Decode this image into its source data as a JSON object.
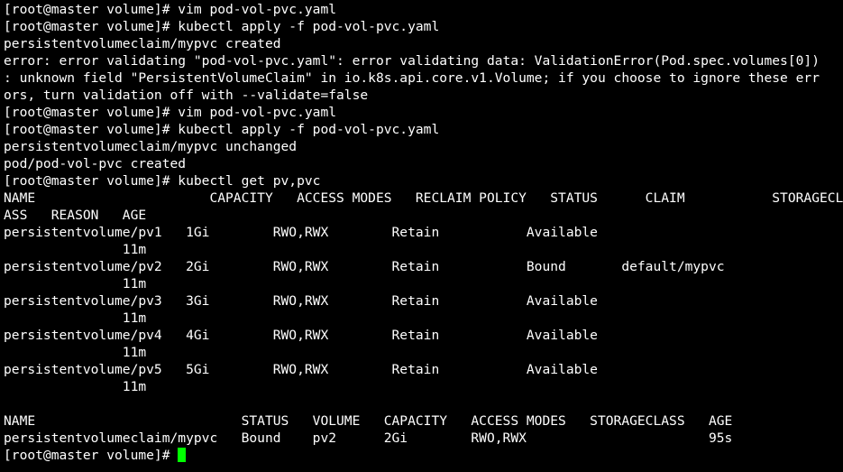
{
  "colors": {
    "background": "#000000",
    "foreground": "#ffffff",
    "cursor": "#00ff00"
  },
  "lines": [
    "[root@master volume]# vim pod-vol-pvc.yaml",
    "[root@master volume]# kubectl apply -f pod-vol-pvc.yaml",
    "persistentvolumeclaim/mypvc created",
    "error: error validating \"pod-vol-pvc.yaml\": error validating data: ValidationError(Pod.spec.volumes[0])",
    ": unknown field \"PersistentVolumeClaim\" in io.k8s.api.core.v1.Volume; if you choose to ignore these err",
    "ors, turn validation off with --validate=false",
    "[root@master volume]# vim pod-vol-pvc.yaml",
    "[root@master volume]# kubectl apply -f pod-vol-pvc.yaml",
    "persistentvolumeclaim/mypvc unchanged",
    "pod/pod-vol-pvc created",
    "[root@master volume]# kubectl get pv,pvc",
    "NAME                      CAPACITY   ACCESS MODES   RECLAIM POLICY   STATUS      CLAIM           STORAGECL",
    "ASS   REASON   AGE",
    "persistentvolume/pv1   1Gi        RWO,RWX        Retain           Available",
    "               11m",
    "persistentvolume/pv2   2Gi        RWO,RWX        Retain           Bound       default/mypvc",
    "               11m",
    "persistentvolume/pv3   3Gi        RWO,RWX        Retain           Available",
    "               11m",
    "persistentvolume/pv4   4Gi        RWO,RWX        Retain           Available",
    "               11m",
    "persistentvolume/pv5   5Gi        RWO,RWX        Retain           Available",
    "               11m",
    "",
    "NAME                          STATUS   VOLUME   CAPACITY   ACCESS MODES   STORAGECLASS   AGE",
    "persistentvolumeclaim/mypvc   Bound    pv2      2Gi        RWO,RWX                       95s"
  ],
  "prompt": "[root@master volume]# "
}
